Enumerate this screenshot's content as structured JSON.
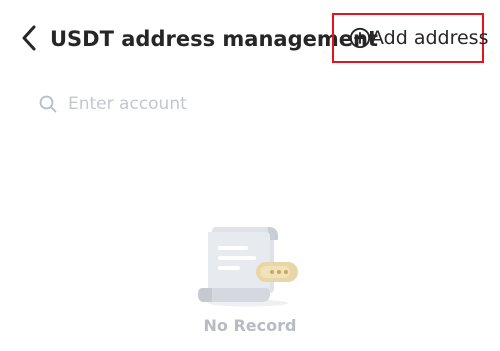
{
  "header": {
    "back_icon": "chevron-left-icon",
    "title": "USDT address management",
    "add_button": {
      "icon": "plus-circle-icon",
      "label": "Add address",
      "highlight_color": "#e5131c"
    }
  },
  "search": {
    "icon": "search-icon",
    "placeholder": "Enter account",
    "value": ""
  },
  "empty_state": {
    "illustration": "document-scroll-icon",
    "message": "No Record"
  }
}
